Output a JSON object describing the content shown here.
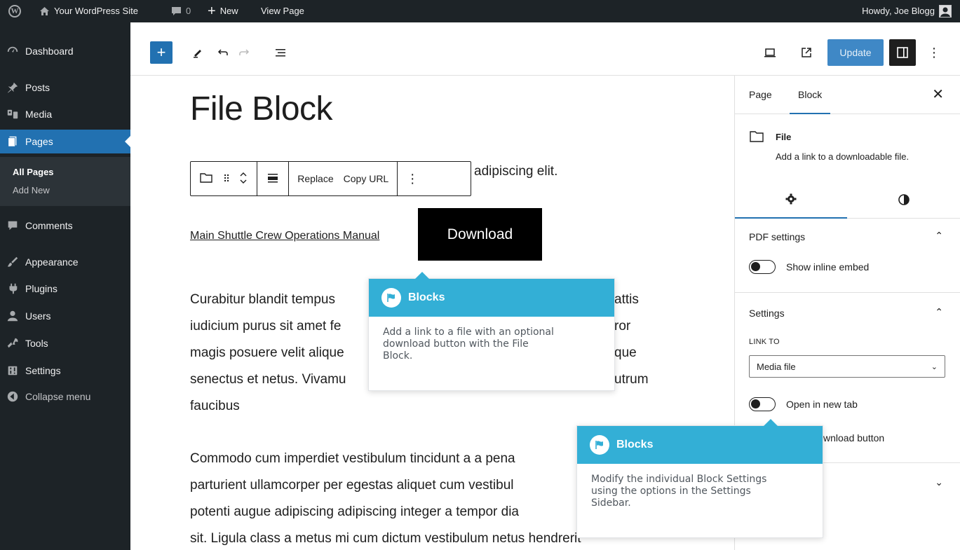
{
  "admin_bar": {
    "site_name": "Your WordPress Site",
    "comments_count": "0",
    "new_label": "New",
    "view_page_label": "View Page",
    "greeting": "Howdy, Joe Blogg"
  },
  "admin_menu": {
    "items": [
      {
        "label": "Dashboard",
        "icon": "dashboard-icon"
      },
      {
        "label": "Posts",
        "icon": "pin-icon"
      },
      {
        "label": "Media",
        "icon": "media-icon"
      },
      {
        "label": "Pages",
        "icon": "pages-icon",
        "current": true
      },
      {
        "label": "Comments",
        "icon": "comment-icon"
      },
      {
        "label": "Appearance",
        "icon": "brush-icon"
      },
      {
        "label": "Plugins",
        "icon": "plug-icon"
      },
      {
        "label": "Users",
        "icon": "users-icon"
      },
      {
        "label": "Tools",
        "icon": "wrench-icon"
      },
      {
        "label": "Settings",
        "icon": "settings-icon"
      },
      {
        "label": "Collapse menu",
        "icon": "collapse-icon"
      }
    ],
    "submenu": [
      {
        "label": "All Pages",
        "active": true
      },
      {
        "label": "Add New"
      }
    ],
    "accent_color": "#2271b1"
  },
  "toolbar": {
    "update_label": "Update"
  },
  "canvas": {
    "title": "File Block",
    "para1_tail": "adipiscing elit.",
    "block_toolbar": {
      "replace_label": "Replace",
      "copy_url_label": "Copy URL"
    },
    "file_link": "Main Shuttle Crew Operations Manual",
    "download_label": "Download",
    "para2_lines": [
      "Curabitur blandit tempus",
      "iudicium purus sit amet fe",
      "magis posuere velit alique",
      "senectus et netus. Vivamu",
      "faucibus"
    ],
    "para2_right": [
      "attis",
      "ror",
      "que",
      "utrum"
    ],
    "para3_lines": [
      "Commodo cum imperdiet vestibulum tincidunt a a pena",
      "parturient ullamcorper per egestas aliquet cum vestibul",
      "potenti augue adipiscing adipiscing integer a tempor dia",
      "sit. Ligula class a metus mi cum dictum vestibulum netus hendrerit"
    ]
  },
  "sidebar": {
    "tab_page": "Page",
    "tab_block": "Block",
    "block_title": "File",
    "block_desc": "Add a link to a downloadable file.",
    "pdf_settings_title": "PDF settings",
    "show_inline_embed": "Show inline embed",
    "settings_title": "Settings",
    "link_to_label": "LINK TO",
    "link_to_value": "Media file",
    "open_new_tab": "Open in new tab",
    "download_button_partial": "wnload button"
  },
  "tooltips": [
    {
      "title": "Blocks",
      "body": "Add a link to a file with an optional\ndownload button with the File\nBlock."
    },
    {
      "title": "Blocks",
      "body": "Modify the individual Block Settings\nusing the options in the Settings\nSidebar."
    }
  ],
  "colors": {
    "tooltip_header": "#33afd6",
    "admin_dark": "#1d2327",
    "update_button": "#3582c4"
  }
}
